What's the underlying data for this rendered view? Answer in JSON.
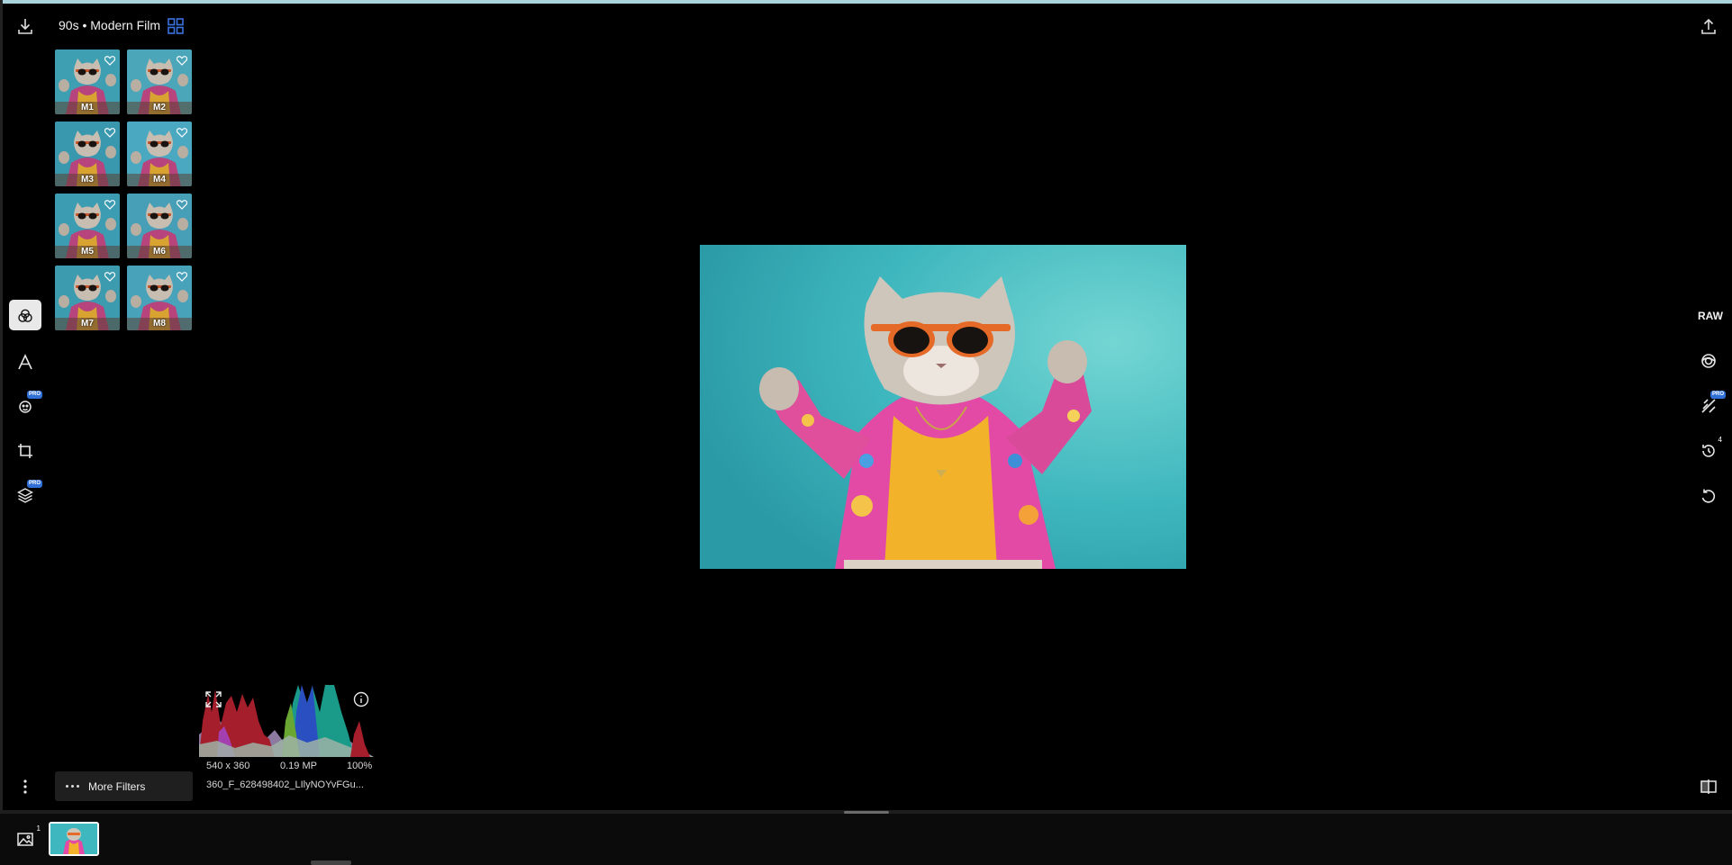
{
  "header": {
    "title": "90s • Modern Film",
    "download_icon": "download-icon",
    "grid_icon": "grid-view-icon",
    "export_icon": "upload-icon"
  },
  "presets": [
    {
      "label": "M1"
    },
    {
      "label": "M2"
    },
    {
      "label": "M3"
    },
    {
      "label": "M4"
    },
    {
      "label": "M5"
    },
    {
      "label": "M6"
    },
    {
      "label": "M7"
    },
    {
      "label": "M8"
    }
  ],
  "left_tools": [
    {
      "name": "filters-icon",
      "active": true
    },
    {
      "name": "text-icon"
    },
    {
      "name": "face-retouch-icon",
      "badge": "PRO"
    },
    {
      "name": "crop-icon"
    },
    {
      "name": "layers-icon",
      "badge": "PRO"
    }
  ],
  "right_tools": {
    "raw_label": "RAW",
    "items": [
      {
        "name": "lens-icon"
      },
      {
        "name": "heal-brush-icon",
        "badge": "PRO"
      },
      {
        "name": "history-icon",
        "count": "4"
      },
      {
        "name": "reset-icon"
      },
      {
        "name": "compare-icon"
      }
    ]
  },
  "info": {
    "dimensions": "540 x 360",
    "megapixels": "0.19 MP",
    "zoom": "100%",
    "filename": "360_F_628498402_LIlyNOYvFGu..."
  },
  "more_filters": {
    "label": "More Filters"
  },
  "filmstrip": {
    "count": "1"
  },
  "colors": {
    "accent": "#2f6fd6",
    "photo_bg": "#3fb7be",
    "top_line": "#a9d4dc"
  }
}
